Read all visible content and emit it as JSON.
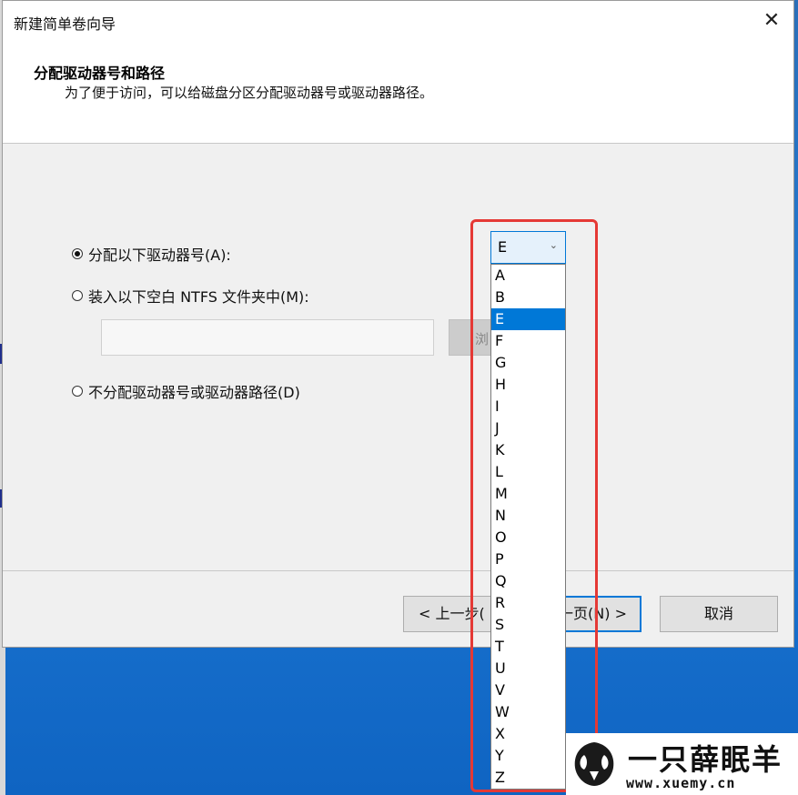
{
  "dialog": {
    "title": "新建简单卷向导",
    "close_glyph": "✕",
    "header_title": "分配驱动器号和路径",
    "header_subtitle": "为了便于访问，可以给磁盘分区分配驱动器号或驱动器路径。"
  },
  "options": {
    "assign_letter": "分配以下驱动器号(A):",
    "mount_folder": "装入以下空白 NTFS 文件夹中(M):",
    "no_assign": "不分配驱动器号或驱动器路径(D)",
    "selected": "assign_letter"
  },
  "browse_button": "浏",
  "drive_combo": {
    "value": "E",
    "arrow": "⌄",
    "options": [
      "A",
      "B",
      "E",
      "F",
      "G",
      "H",
      "I",
      "J",
      "K",
      "L",
      "M",
      "N",
      "O",
      "P",
      "Q",
      "R",
      "S",
      "T",
      "U",
      "V",
      "W",
      "X",
      "Y",
      "Z"
    ]
  },
  "footer": {
    "back_label": "< 上一步(",
    "next_label": "一页(N) >",
    "cancel_label": "取消"
  },
  "watermark": {
    "text": "一只薛眠羊",
    "url": "www.xuemy.cn"
  },
  "colors": {
    "accent": "#0078d7",
    "highlight": "#e53935"
  }
}
